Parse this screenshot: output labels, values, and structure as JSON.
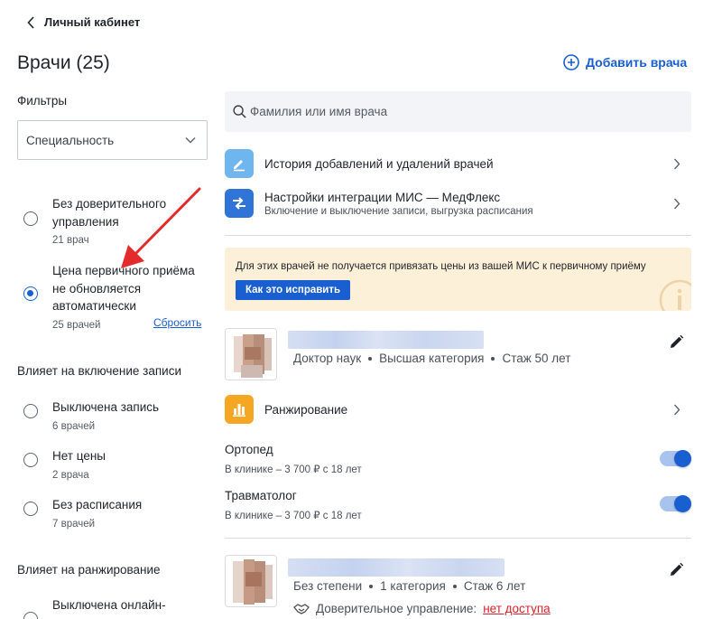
{
  "header": {
    "back_label": "Личный кабинет",
    "title": "Врачи (25)",
    "add_doctor_label": "Добавить врача"
  },
  "filters": {
    "title": "Фильтры",
    "specialty_select": "Специальность",
    "group1": [
      {
        "label": "Без доверительного управления",
        "count": "21 врач",
        "checked": false
      },
      {
        "label": "Цена первичного приёма не обновляется автоматически",
        "count": "25 врачей",
        "checked": true
      }
    ],
    "reset_label": "Сбросить",
    "section2_title": "Влияет на включение записи",
    "group2": [
      {
        "label": "Выключена запись",
        "count": "6 врачей"
      },
      {
        "label": "Нет цены",
        "count": "2 врача"
      },
      {
        "label": "Без расписания",
        "count": "7 врачей"
      }
    ],
    "section3_title": "Влияет на ранжирование",
    "group3": [
      {
        "label": "Выключена онлайн-"
      }
    ]
  },
  "search": {
    "placeholder": "Фамилия или имя врача"
  },
  "menu": [
    {
      "title": "История добавлений и удалений врачей",
      "subtitle": ""
    },
    {
      "title": "Настройки интеграции МИС — МедФлекс",
      "subtitle": "Включение и выключение записи, выгрузка расписания"
    }
  ],
  "warning": {
    "text": "Для этих врачей не получается привязать цены из вашей МИС к первичному приёму",
    "button": "Как это исправить"
  },
  "doctors": [
    {
      "meta": [
        "Доктор наук",
        "Высшая категория",
        "Стаж 50 лет"
      ],
      "ranking_label": "Ранжирование",
      "specialties": [
        {
          "name": "Ортопед",
          "price": "В клинике – 3 700 ₽ с 18 лет",
          "enabled": true
        },
        {
          "name": "Травматолог",
          "price": "В клинике – 3 700 ₽ с 18 лет",
          "enabled": true
        }
      ]
    },
    {
      "meta": [
        "Без степени",
        "1 категория",
        "Стаж 6 лет"
      ],
      "trust_label": "Доверительное управление:",
      "trust_value": "нет доступа"
    }
  ],
  "colors": {
    "accent": "#1a5fd0",
    "warning_bg": "#fdf0d9",
    "history_icon_bg": "#6fb6ee",
    "integration_icon_bg": "#2f74d6",
    "ranking_icon_bg": "#f5a623",
    "danger": "#d8232a"
  }
}
